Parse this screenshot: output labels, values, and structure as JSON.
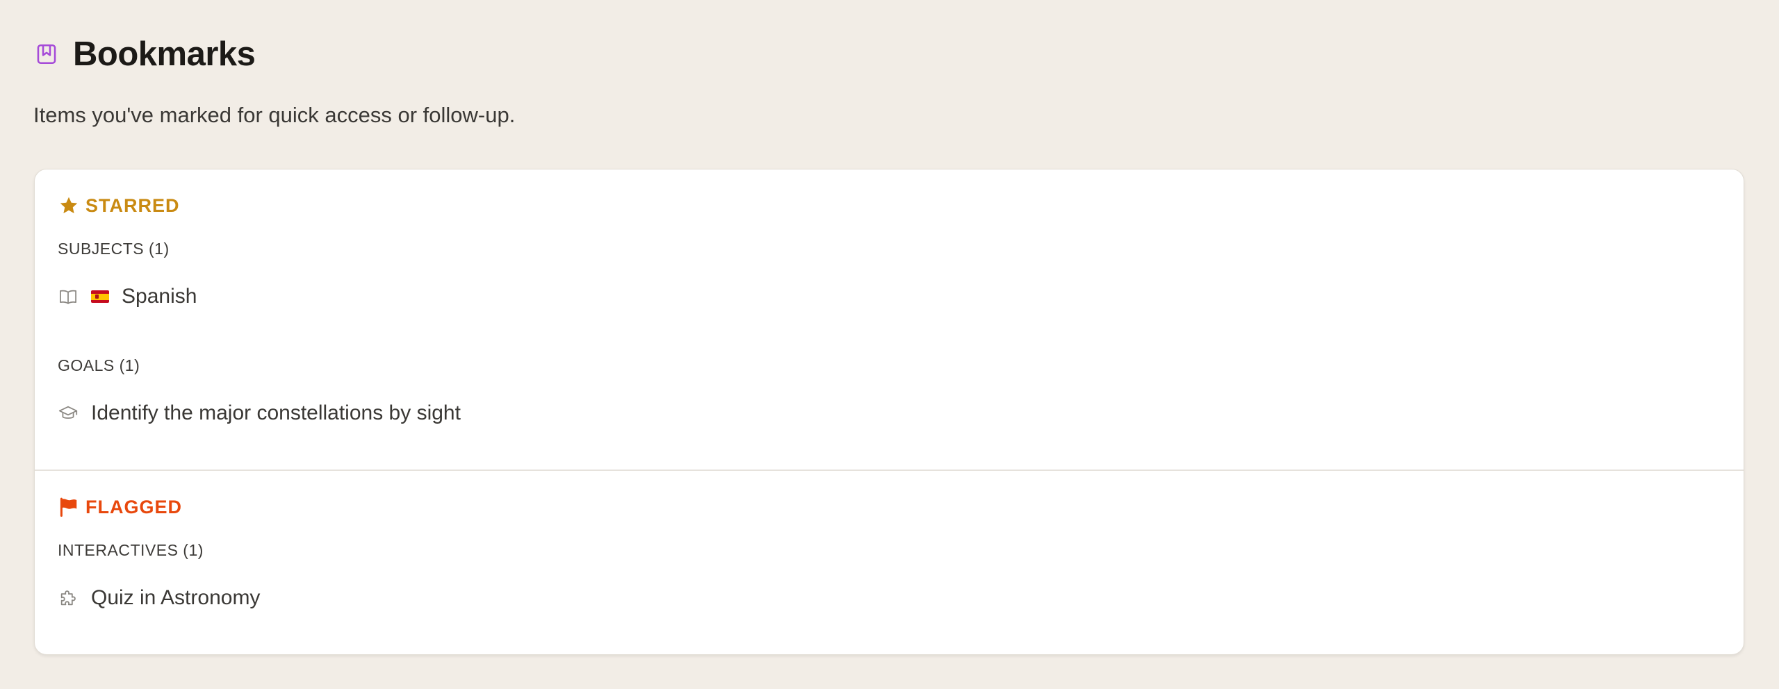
{
  "header": {
    "title": "Bookmarks",
    "subtitle": "Items you've marked for quick access or follow-up.",
    "icon": "bookmark-icon",
    "icon_color": "#a64bd8"
  },
  "starred": {
    "heading": "STARRED",
    "icon": "star-icon",
    "color": "#c98a12",
    "groups": [
      {
        "label": "SUBJECTS (1)",
        "items": [
          {
            "icon": "book-icon",
            "emoji": "spain-flag",
            "label": "Spanish"
          }
        ]
      },
      {
        "label": "GOALS (1)",
        "items": [
          {
            "icon": "graduation-cap-icon",
            "label": "Identify the major constellations by sight"
          }
        ]
      }
    ]
  },
  "flagged": {
    "heading": "FLAGGED",
    "icon": "flag-icon",
    "color": "#e8480d",
    "groups": [
      {
        "label": "INTERACTIVES (1)",
        "items": [
          {
            "icon": "puzzle-icon",
            "label": "Quiz in Astronomy"
          }
        ]
      }
    ]
  }
}
